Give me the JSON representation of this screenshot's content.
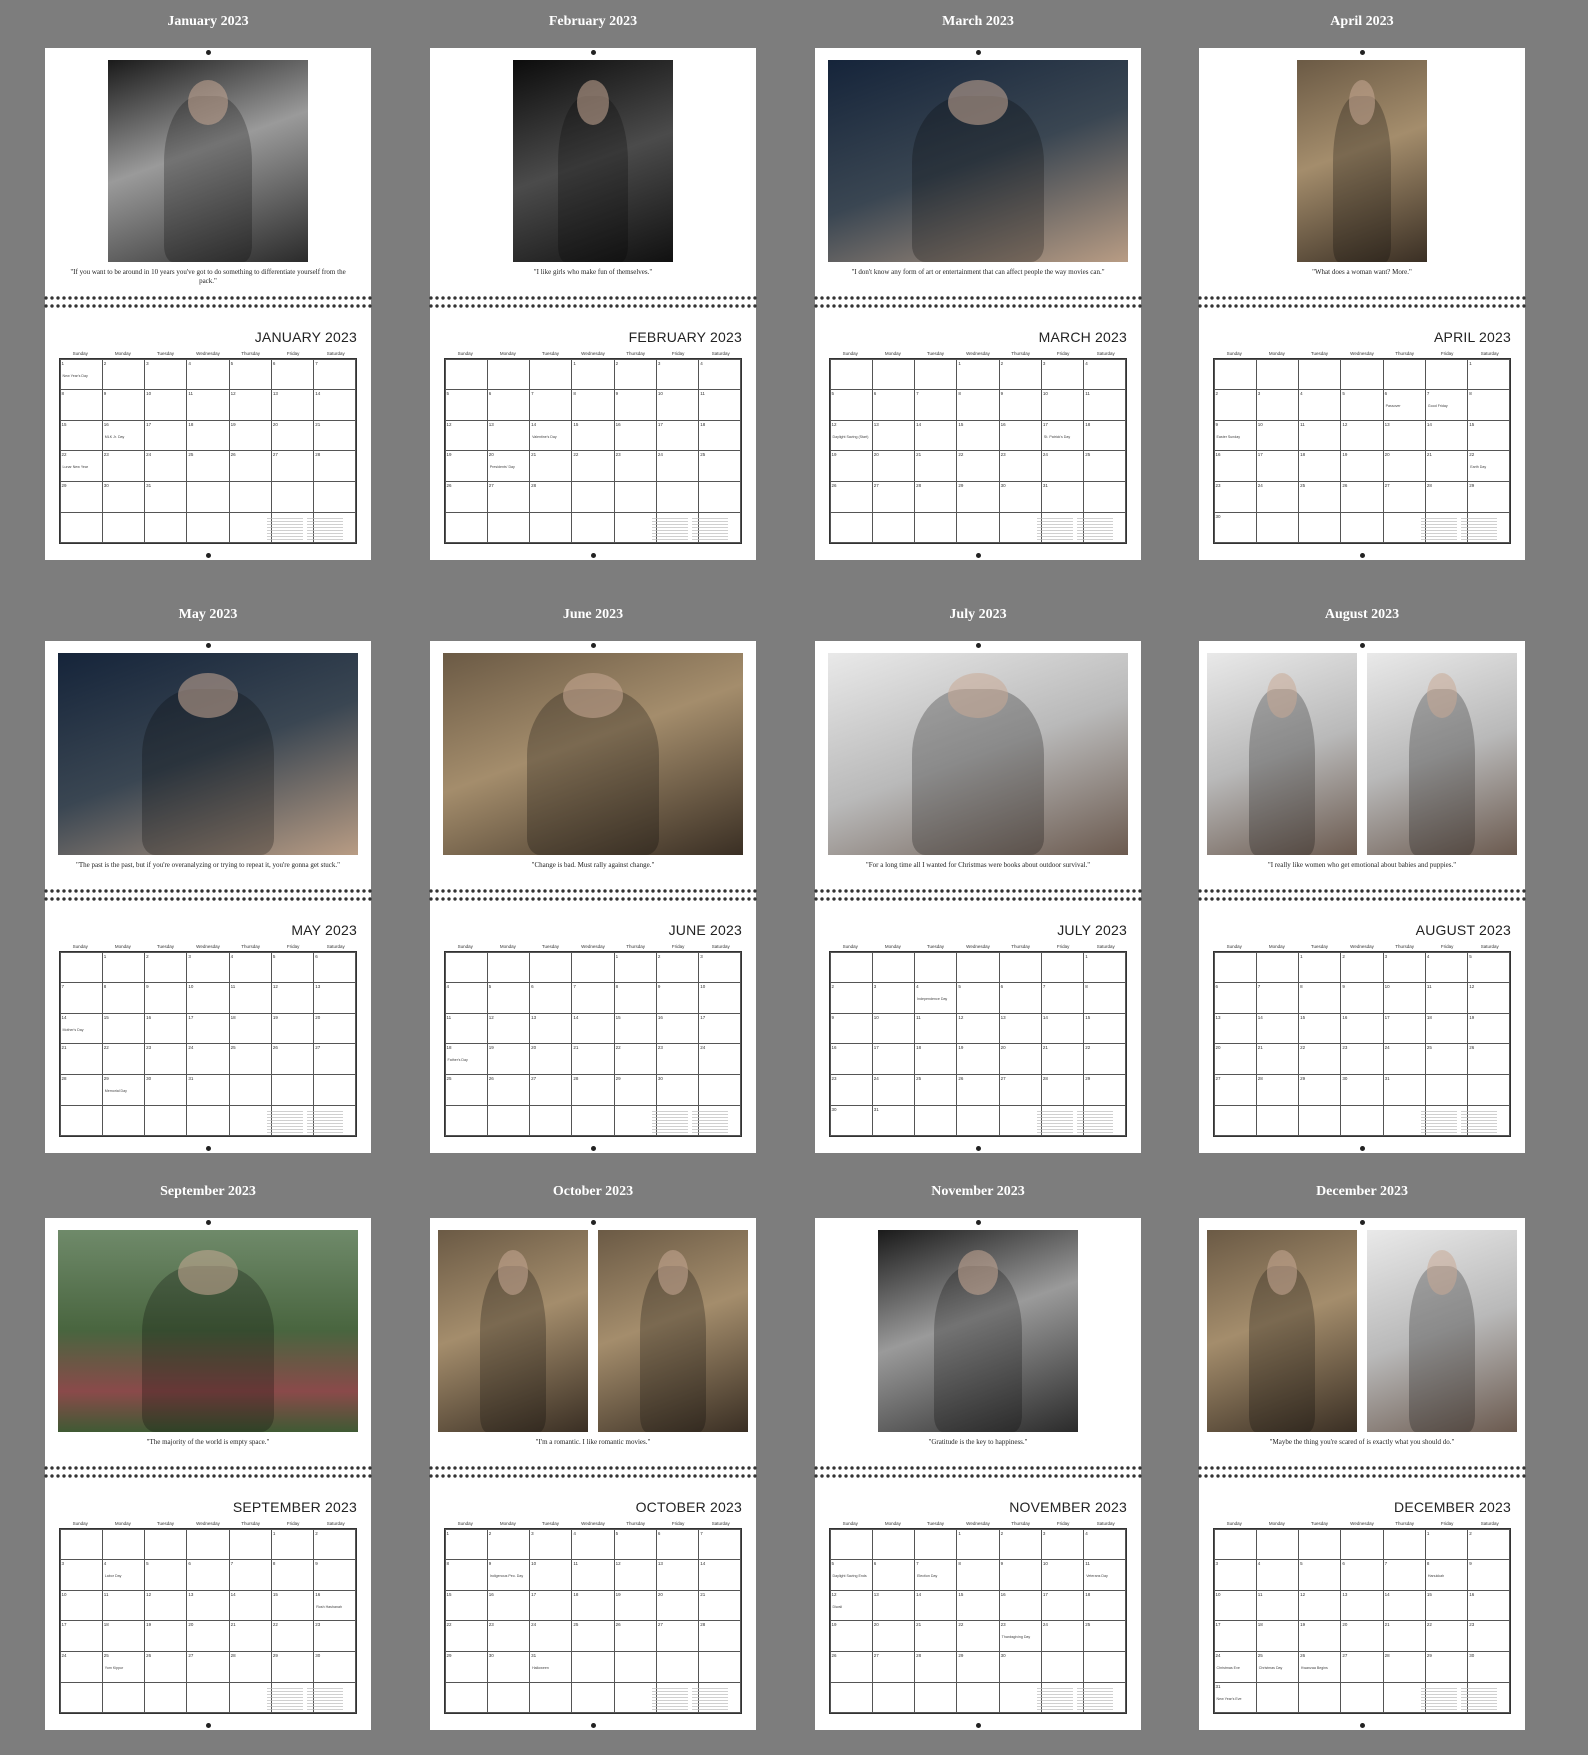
{
  "weekdays": [
    "Sunday",
    "Monday",
    "Tuesday",
    "Wednesday",
    "Thursday",
    "Friday",
    "Saturday"
  ],
  "months": [
    {
      "label": "January 2023",
      "title": "JANUARY 2023",
      "quote": "\"If you want to be around in 10 years you've got to do something to differentiate yourself from the pack.\"",
      "start": 0,
      "days": 31,
      "photos": [
        "bw"
      ],
      "holidays": {
        "1": "New Year's Day",
        "16": "MLK Jr. Day",
        "22": "Lunar New Year"
      }
    },
    {
      "label": "February 2023",
      "title": "FEBRUARY 2023",
      "quote": "\"I like girls who make fun of themselves.\"",
      "start": 3,
      "days": 28,
      "photos": [
        "dark"
      ],
      "holidays": {
        "14": "Valentine's Day",
        "20": "Presidents' Day"
      }
    },
    {
      "label": "March 2023",
      "title": "MARCH 2023",
      "quote": "\"I don't know any form of art or entertainment that can affect people the way movies can.\"",
      "start": 3,
      "days": 31,
      "photos": [
        "navy"
      ],
      "holidays": {
        "12": "Daylight Saving (Start)",
        "17": "St. Patrick's Day"
      }
    },
    {
      "label": "April 2023",
      "title": "APRIL 2023",
      "quote": "\"What does a woman want? More.\"",
      "start": 6,
      "days": 30,
      "photos": [
        "warm"
      ],
      "holidays": {
        "6": "Passover",
        "7": "Good Friday",
        "9": "Easter Sunday",
        "22": "Earth Day"
      }
    },
    {
      "label": "May 2023",
      "title": "MAY 2023",
      "quote": "\"The past is the past, but if you're overanalyzing or trying to repeat it, you're gonna get stuck.\"",
      "start": 1,
      "days": 31,
      "photos": [
        "navy"
      ],
      "holidays": {
        "14": "Mother's Day",
        "29": "Memorial Day"
      }
    },
    {
      "label": "June 2023",
      "title": "JUNE 2023",
      "quote": "\"Change is bad. Must rally against change.\"",
      "start": 4,
      "days": 30,
      "photos": [
        "warm"
      ],
      "holidays": {
        "18": "Father's Day"
      }
    },
    {
      "label": "July 2023",
      "title": "JULY 2023",
      "quote": "\"For a long time all I wanted for Christmas were books about outdoor survival.\"",
      "start": 6,
      "days": 31,
      "photos": [
        "light"
      ],
      "holidays": {
        "4": "Independence Day"
      }
    },
    {
      "label": "August 2023",
      "title": "AUGUST 2023",
      "quote": "\"I really like women who get emotional about babies and puppies.\"",
      "start": 2,
      "days": 31,
      "photos": [
        "light",
        "light"
      ],
      "holidays": {}
    },
    {
      "label": "September 2023",
      "title": "SEPTEMBER 2023",
      "quote": "\"The majority of the world is empty space.\"",
      "start": 5,
      "days": 30,
      "photos": [
        "green"
      ],
      "holidays": {
        "4": "Labor Day",
        "16": "Rosh Hashanah",
        "25": "Yom Kippur"
      }
    },
    {
      "label": "October 2023",
      "title": "OCTOBER 2023",
      "quote": "\"I'm a romantic. I like romantic movies.\"",
      "start": 0,
      "days": 31,
      "photos": [
        "warm",
        "warm"
      ],
      "holidays": {
        "9": "Indigenous Peo. Day",
        "31": "Halloween"
      }
    },
    {
      "label": "November 2023",
      "title": "NOVEMBER 2023",
      "quote": "\"Gratitude is the key to happiness.\"",
      "start": 3,
      "days": 30,
      "photos": [
        "bw"
      ],
      "holidays": {
        "5": "Daylight Saving Ends",
        "7": "Election Day",
        "11": "Veterans Day",
        "12": "Diwali",
        "23": "Thanksgiving Day"
      }
    },
    {
      "label": "December 2023",
      "title": "DECEMBER 2023",
      "quote": "\"Maybe the thing you're scared of is exactly what you should do.\"",
      "start": 5,
      "days": 31,
      "photos": [
        "warm",
        "light"
      ],
      "holidays": {
        "8": "Hanukkah",
        "24": "Christmas Eve",
        "25": "Christmas Day",
        "26": "Kwanzaa Begins",
        "31": "New Year's Eve"
      }
    }
  ]
}
